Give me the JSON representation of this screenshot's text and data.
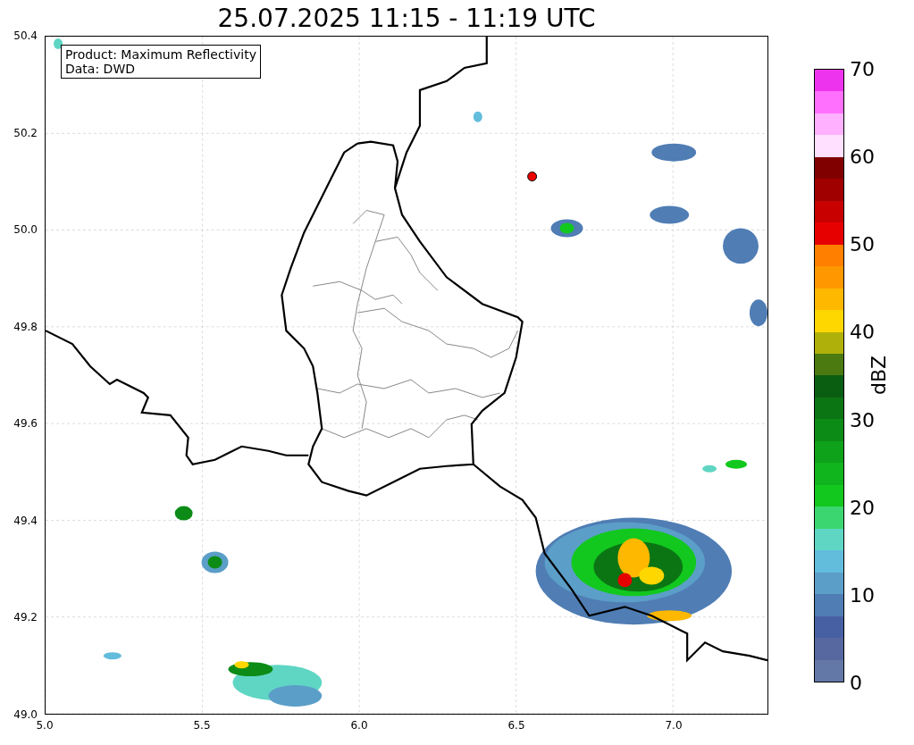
{
  "title": "25.07.2025 11:15 - 11:19 UTC",
  "info_box": {
    "lines": [
      "Product: Maximum Reflectivity",
      "Data: DWD"
    ]
  },
  "y_axis": {
    "ticks": [
      "50.4",
      "50.2",
      "50.0",
      "49.8",
      "49.6",
      "49.4",
      "49.2",
      "49.0"
    ]
  },
  "x_axis": {
    "ticks": [
      "5.0",
      "5.5",
      "6.0",
      "6.5",
      "7.0"
    ]
  },
  "colorbar": {
    "label": "dBZ",
    "ticks": [
      "70",
      "60",
      "50",
      "40",
      "30",
      "20",
      "10",
      "0"
    ],
    "segments": [
      {
        "color": "#6478a8"
      },
      {
        "color": "#56689f"
      },
      {
        "color": "#4760a3"
      },
      {
        "color": "#4f7db4"
      },
      {
        "color": "#5b9ec8"
      },
      {
        "color": "#62bcdc"
      },
      {
        "color": "#5fd6c4"
      },
      {
        "color": "#3cd670"
      },
      {
        "color": "#12c81e"
      },
      {
        "color": "#10b41c"
      },
      {
        "color": "#0ea11a"
      },
      {
        "color": "#0c8c16"
      },
      {
        "color": "#0b7514"
      },
      {
        "color": "#0a5e12"
      },
      {
        "color": "#4a7a10"
      },
      {
        "color": "#b0b00a"
      },
      {
        "color": "#ffd700"
      },
      {
        "color": "#ffb800"
      },
      {
        "color": "#ff9800"
      },
      {
        "color": "#ff7f00"
      },
      {
        "color": "#e60000"
      },
      {
        "color": "#c80000"
      },
      {
        "color": "#a00000"
      },
      {
        "color": "#800000"
      },
      {
        "color": "#ffe0ff"
      },
      {
        "color": "#ffb0ff"
      },
      {
        "color": "#ff70ff"
      },
      {
        "color": "#ee33ee"
      }
    ]
  }
}
